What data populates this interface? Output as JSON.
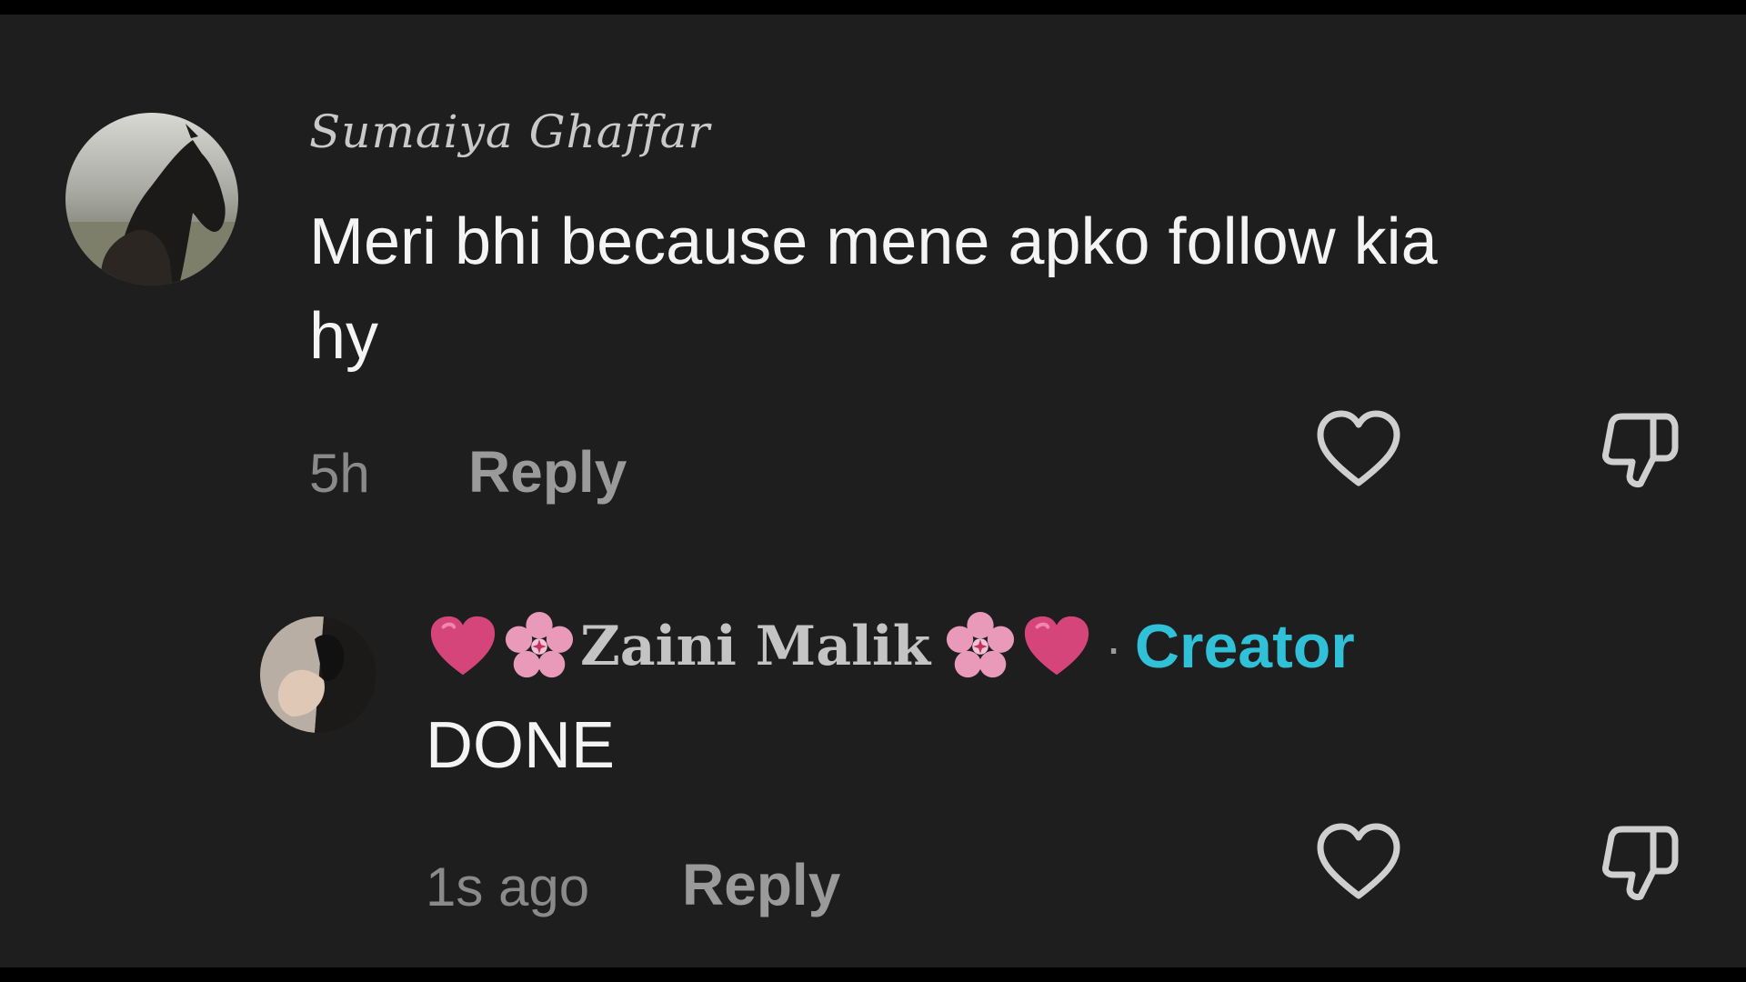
{
  "comments": [
    {
      "username": "Sumaiya Ghaffar",
      "text_line1": "Meri bhi because mene apko follow kia",
      "text_line2": "hy",
      "time": "5h",
      "reply_label": "Reply",
      "avatar": "horse-photo-avatar"
    }
  ],
  "replies": [
    {
      "username": "Zaini Malik",
      "emoji_left": [
        "heart-emoji",
        "cherry-blossom-emoji"
      ],
      "emoji_right": [
        "cherry-blossom-emoji",
        "heart-emoji"
      ],
      "separator": "·",
      "badge": "Creator",
      "text": "DONE",
      "time": "1s ago",
      "reply_label": "Reply",
      "avatar": "person-photo-avatar"
    }
  ],
  "icons": {
    "like": "heart-outline-icon",
    "dislike": "thumbs-down-icon"
  },
  "colors": {
    "background": "#1e1e1f",
    "frame": "#000000",
    "text_primary": "#f4f4f4",
    "text_secondary": "#8a8a8a",
    "creator_accent": "#30c0d8",
    "heart_emoji": "#d6457a",
    "flower_emoji": "#e89ab8"
  }
}
